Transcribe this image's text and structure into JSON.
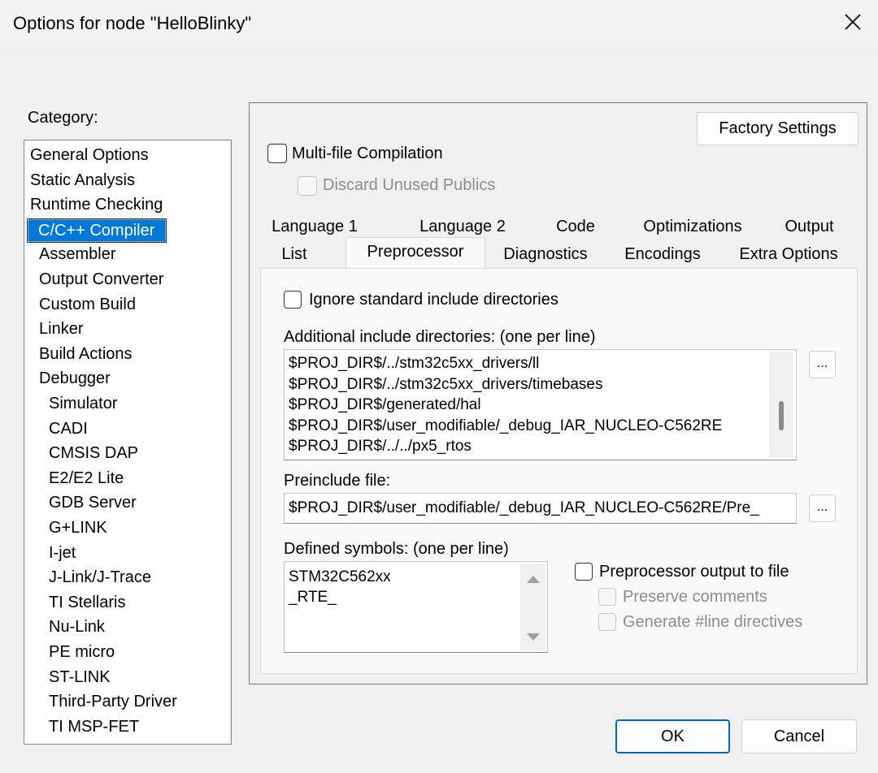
{
  "window": {
    "title": "Options for node \"HelloBlinky\"",
    "close_icon": "close-icon"
  },
  "category": {
    "label": "Category:",
    "items": [
      {
        "label": "General Options",
        "level": 0
      },
      {
        "label": "Static Analysis",
        "level": 0
      },
      {
        "label": "Runtime Checking",
        "level": 0
      },
      {
        "label": "C/C++ Compiler",
        "level": 1,
        "selected": true
      },
      {
        "label": "Assembler",
        "level": 1
      },
      {
        "label": "Output Converter",
        "level": 1
      },
      {
        "label": "Custom Build",
        "level": 1
      },
      {
        "label": "Linker",
        "level": 1
      },
      {
        "label": "Build Actions",
        "level": 1
      },
      {
        "label": "Debugger",
        "level": 1
      },
      {
        "label": "Simulator",
        "level": 2
      },
      {
        "label": "CADI",
        "level": 2
      },
      {
        "label": "CMSIS DAP",
        "level": 2
      },
      {
        "label": "E2/E2 Lite",
        "level": 2
      },
      {
        "label": "GDB Server",
        "level": 2
      },
      {
        "label": "G+LINK",
        "level": 2
      },
      {
        "label": "I-jet",
        "level": 2
      },
      {
        "label": "J-Link/J-Trace",
        "level": 2
      },
      {
        "label": "TI Stellaris",
        "level": 2
      },
      {
        "label": "Nu-Link",
        "level": 2
      },
      {
        "label": "PE micro",
        "level": 2
      },
      {
        "label": "ST-LINK",
        "level": 2
      },
      {
        "label": "Third-Party Driver",
        "level": 2
      },
      {
        "label": "TI MSP-FET",
        "level": 2
      }
    ]
  },
  "panel": {
    "factory_settings": "Factory Settings",
    "multi_file": "Multi-file Compilation",
    "discard_unused": "Discard Unused Publics"
  },
  "tabs": {
    "row1": [
      "Language 1",
      "Language 2",
      "Code",
      "Optimizations",
      "Output"
    ],
    "row2": [
      "List",
      "Preprocessor",
      "Diagnostics",
      "Encodings",
      "Extra Options"
    ],
    "active": "Preprocessor"
  },
  "preprocessor": {
    "ignore_std": "Ignore standard include directories",
    "include_label": "Additional include directories: (one per line)",
    "include_dirs": [
      "$PROJ_DIR$/../stm32c5xx_drivers/ll",
      "$PROJ_DIR$/../stm32c5xx_drivers/timebases",
      "$PROJ_DIR$/generated/hal",
      "$PROJ_DIR$/user_modifiable/_debug_IAR_NUCLEO-C562RE",
      "$PROJ_DIR$/../../px5_rtos"
    ],
    "browse": "...",
    "preinclude_label": "Preinclude file:",
    "preinclude_value": "$PROJ_DIR$/user_modifiable/_debug_IAR_NUCLEO-C562RE/Pre_",
    "symbols_label": "Defined symbols: (one per line)",
    "symbols": [
      "STM32C562xx",
      "_RTE_"
    ],
    "output_to_file": "Preprocessor output to file",
    "preserve_comments": "Preserve comments",
    "generate_line": "Generate #line directives"
  },
  "buttons": {
    "ok": "OK",
    "cancel": "Cancel"
  }
}
